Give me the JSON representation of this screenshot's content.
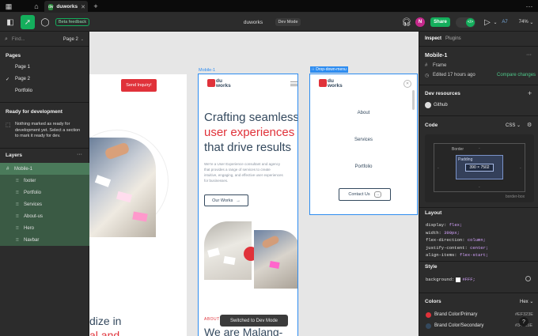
{
  "titlebar": {
    "tab_title": "duworks",
    "tab_favicon": "dw"
  },
  "toolbar": {
    "beta_feedback": "Beta feedback",
    "file_name": "duworks",
    "mode": "Dev Mode",
    "avatar_letter": "N",
    "share": "Share",
    "zoom": "74%"
  },
  "left": {
    "find_placeholder": "Find...",
    "current_page": "Page 2",
    "pages_title": "Pages",
    "pages": [
      "Page 1",
      "Page 2",
      "Portfolio"
    ],
    "ready_title": "Ready for development",
    "ready_text": "Nothing marked as ready for development yet. Select a section to mark it ready for dev.",
    "layers_title": "Layers",
    "layers": [
      "Mobile-1",
      "footer",
      "Portfolio",
      "Services",
      "About-us",
      "Hero",
      "Navbar"
    ]
  },
  "canvas": {
    "frame_label_mobile": "Mobile-1",
    "frame_label_dropdown": "Drop-down-menu",
    "send_inquiry": "Send Inquiry!",
    "hero_line1": "Crafting seamless",
    "hero_line2": "user experiences",
    "hero_line3": "that drive results",
    "hero_body": "We're a User Experience consultant and agency that provides a range of services to create intuitive, engaging, and effective user experiences for businesses.",
    "our_works": "Our Works",
    "about_label": "ABOUT US",
    "about_heading": "We are Malang-",
    "left_big1": "dize in",
    "left_big2": "al and",
    "menu_items": [
      "About",
      "Services",
      "Portfolio"
    ],
    "contact_us": "Contact Us",
    "toast": "Switched to Dev Mode",
    "logo_text": "du works"
  },
  "right": {
    "tabs": [
      "Inspect",
      "Plugins"
    ],
    "selection_name": "Mobile-1",
    "type": "Frame",
    "edited": "Edited 17 hours ago",
    "compare": "Compare changes",
    "dev_resources": "Dev resources",
    "github": "Github",
    "code_title": "Code",
    "code_lang": "CSS",
    "box_border": "Border",
    "box_padding": "Padding",
    "box_size": "390 × 7502",
    "box_dash": "-",
    "border_box": "border-box",
    "layout_title": "Layout",
    "layout_code": [
      {
        "k": "display: ",
        "v": "flex;"
      },
      {
        "k": "width: ",
        "v": "390px;"
      },
      {
        "k": "flex-direction: ",
        "v": "column;"
      },
      {
        "k": "justify-content: ",
        "v": "center;"
      },
      {
        "k": "align-items: ",
        "v": "flex-start;"
      }
    ],
    "style_title": "Style",
    "style_code": {
      "k": "background: ",
      "v": "#FFF;"
    },
    "colors_title": "Colors",
    "colors_format": "Hex",
    "colors": [
      {
        "name": "Brand Color/Primary",
        "hex": "#EF323E",
        "swatch": "#e0323a"
      },
      {
        "name": "Brand Color/Secondary",
        "hex": "#34495E",
        "swatch": "#34495e"
      }
    ],
    "help": "?"
  },
  "theme": {
    "accent_green": "#14ae5c",
    "brand_red": "#e0323a",
    "selection_blue": "#2d8cf0"
  }
}
